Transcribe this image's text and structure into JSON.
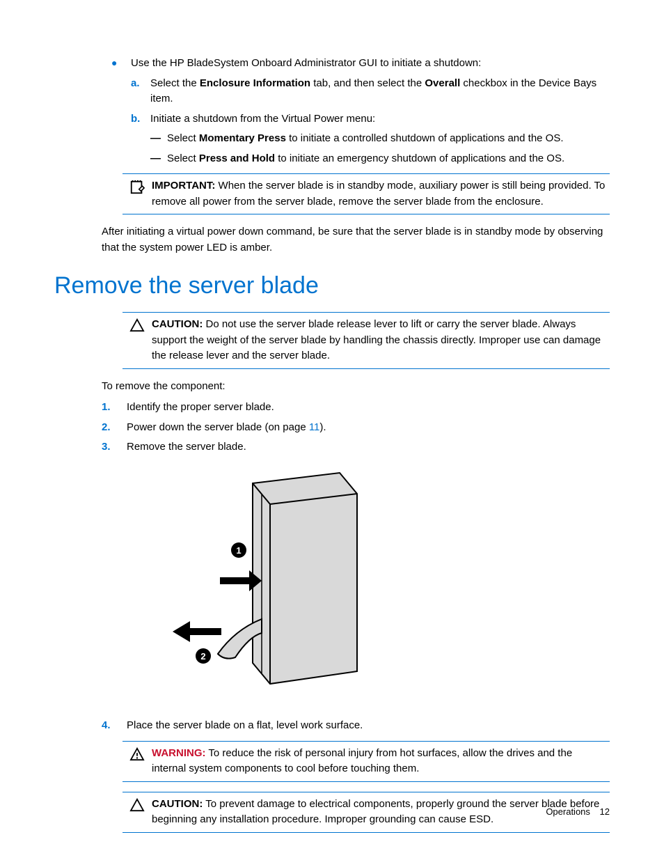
{
  "intro_bullet": "Use the HP BladeSystem Onboard Administrator GUI to initiate a shutdown:",
  "step_a": {
    "marker": "a.",
    "pre": "Select the ",
    "b1": "Enclosure Information",
    "mid": " tab, and then select the ",
    "b2": "Overall",
    "post": " checkbox in the Device Bays item."
  },
  "step_b": {
    "marker": "b.",
    "text": "Initiate a shutdown from the Virtual Power menu:"
  },
  "dash1": {
    "pre": "Select ",
    "b": "Momentary Press",
    "post": " to initiate a controlled shutdown of applications and the OS."
  },
  "dash2": {
    "pre": "Select ",
    "b": "Press and Hold",
    "post": " to initiate an emergency shutdown of applications and the OS."
  },
  "important": {
    "label": "IMPORTANT:",
    "text": "  When the server blade is in standby mode, auxiliary power is still being provided. To remove all power from the server blade, remove the server blade from the enclosure."
  },
  "after_p": "After initiating a virtual power down command, be sure that the server blade is in standby mode by observing that the system power LED is amber.",
  "heading": "Remove the server blade",
  "caution1": {
    "label": "CAUTION:",
    "text": "  Do not use the server blade release lever to lift or carry the server blade. Always support the weight of the server blade by handling the chassis directly. Improper use can damage the release lever and the server blade."
  },
  "remove_intro": "To remove the component:",
  "ol1": {
    "n": "1.",
    "text": "Identify the proper server blade."
  },
  "ol2": {
    "n": "2.",
    "pre": "Power down the server blade (on page ",
    "link": "11",
    "post": ")."
  },
  "ol3": {
    "n": "3.",
    "text": "Remove the server blade."
  },
  "ol4": {
    "n": "4.",
    "text": "Place the server blade on a flat, level work surface."
  },
  "warning": {
    "label": "WARNING:",
    "text": "  To reduce the risk of personal injury from hot surfaces, allow the drives and the internal system components to cool before touching them."
  },
  "caution2": {
    "label": "CAUTION:",
    "text": "  To prevent damage to electrical components, properly ground the server blade before beginning any installation procedure. Improper grounding can cause ESD."
  },
  "footer": {
    "section": "Operations",
    "page": "12"
  }
}
